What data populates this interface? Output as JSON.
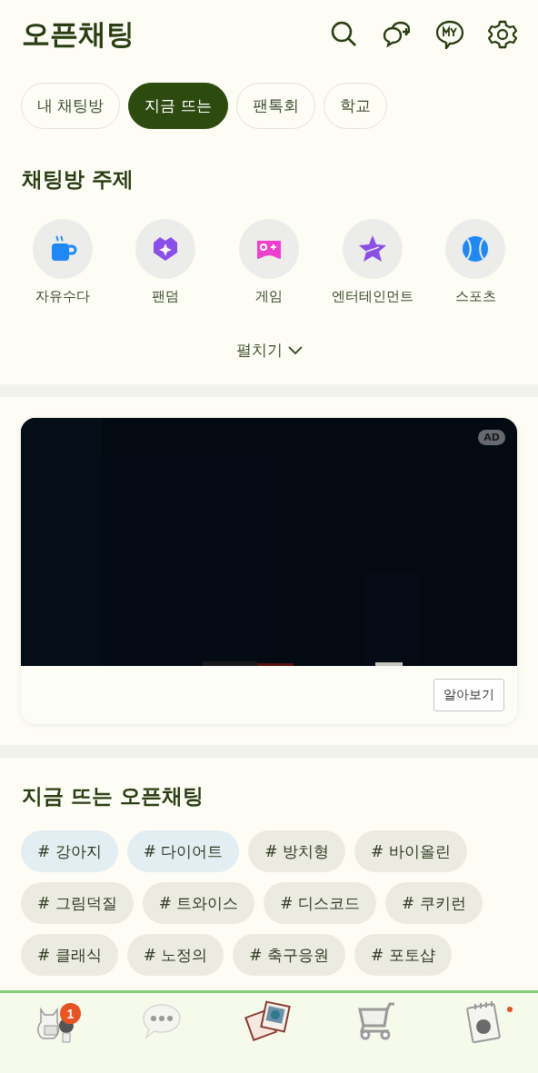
{
  "header": {
    "title": "오픈채팅"
  },
  "tabs": [
    {
      "label": "내 채팅방",
      "selected": false
    },
    {
      "label": "지금 뜨는",
      "selected": true
    },
    {
      "label": "팬톡회",
      "selected": false
    },
    {
      "label": "학교",
      "selected": false
    }
  ],
  "topics": {
    "title": "채팅방 주제",
    "items": [
      {
        "label": "자유수다",
        "kind": "cup",
        "color": "#1e88f5"
      },
      {
        "label": "팬덤",
        "kind": "heart",
        "color": "#8a4fe8"
      },
      {
        "label": "게임",
        "kind": "game",
        "color": "#f03fd0"
      },
      {
        "label": "엔터테인먼트",
        "kind": "star",
        "color": "#8a4fe8"
      },
      {
        "label": "스포츠",
        "kind": "ball",
        "color": "#1e88f5"
      }
    ],
    "expand": "펼치기"
  },
  "ad": {
    "badge": "AD",
    "button": "알아보기"
  },
  "trending": {
    "title": "지금 뜨는 오픈채팅",
    "tags": [
      {
        "label": "# 강아지",
        "highlighted": true
      },
      {
        "label": "# 다이어트",
        "highlighted": true
      },
      {
        "label": "# 방치형",
        "highlighted": false
      },
      {
        "label": "# 바이올린",
        "highlighted": false
      },
      {
        "label": "# 그림덕질",
        "highlighted": false
      },
      {
        "label": "# 트와이스",
        "highlighted": false
      },
      {
        "label": "# 디스코드",
        "highlighted": false
      },
      {
        "label": "# 쿠키런",
        "highlighted": false
      },
      {
        "label": "# 클래식",
        "highlighted": false
      },
      {
        "label": "# 노정의",
        "highlighted": false
      },
      {
        "label": "# 축구응원",
        "highlighted": false
      },
      {
        "label": "# 포토샵",
        "highlighted": false
      }
    ]
  },
  "nav": [
    {
      "kind": "friends",
      "badge": "1",
      "selected": false
    },
    {
      "kind": "chats",
      "selected": false
    },
    {
      "kind": "openchat",
      "selected": true
    },
    {
      "kind": "shopping",
      "selected": false
    },
    {
      "kind": "more",
      "dot": true,
      "selected": false
    }
  ]
}
